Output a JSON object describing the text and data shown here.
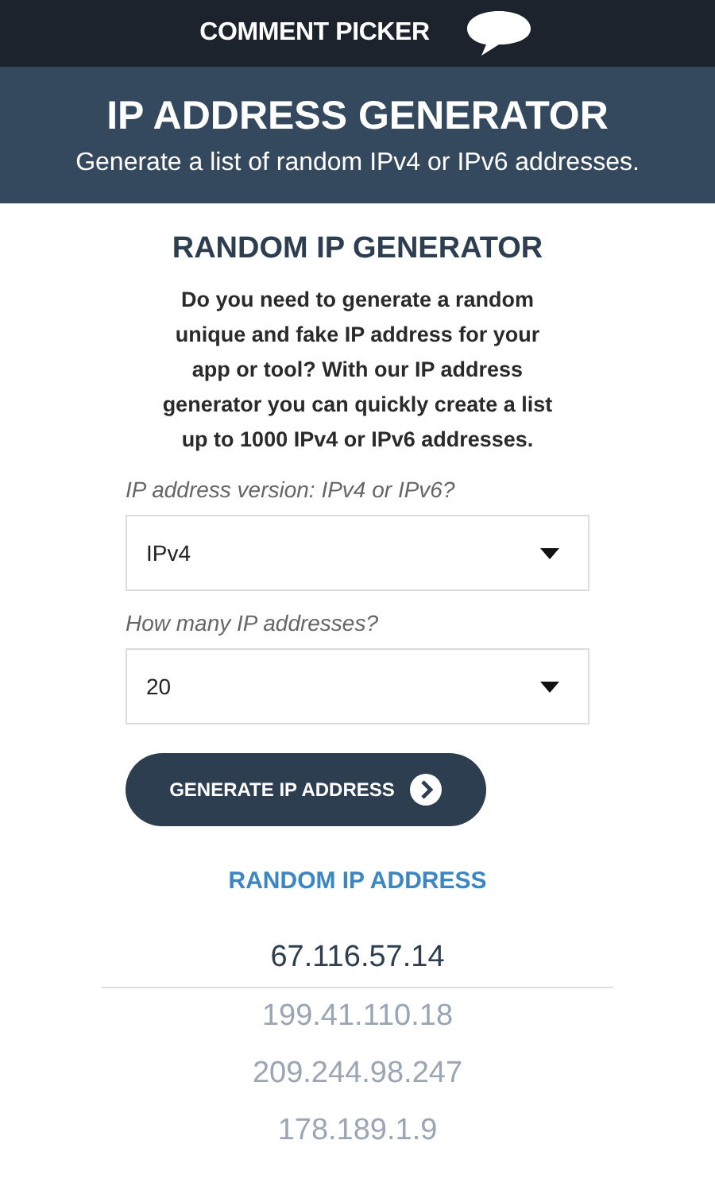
{
  "topbar": {
    "brand": "COMMENT PICKER"
  },
  "hero": {
    "title": "IP ADDRESS GENERATOR",
    "subtitle": "Generate a list of random IPv4 or IPv6 addresses."
  },
  "generator": {
    "heading": "RANDOM IP GENERATOR",
    "intro": "Do you need to generate a random unique and fake IP address for your app or tool? With our IP address generator you can quickly create a list up to 1000 IPv4 or IPv6 addresses.",
    "fields": [
      {
        "label": "IP address version: IPv4 or IPv6?",
        "value": "IPv4"
      },
      {
        "label": "How many IP addresses?",
        "value": "20"
      }
    ],
    "button": "GENERATE IP ADDRESS"
  },
  "results": {
    "heading": "RANDOM IP ADDRESS",
    "addresses": [
      {
        "text": "67.116.57.14",
        "faded": false
      },
      {
        "text": "199.41.110.18",
        "faded": true
      },
      {
        "text": "209.244.98.247",
        "faded": true
      },
      {
        "text": "178.189.1.9",
        "faded": true
      }
    ]
  }
}
